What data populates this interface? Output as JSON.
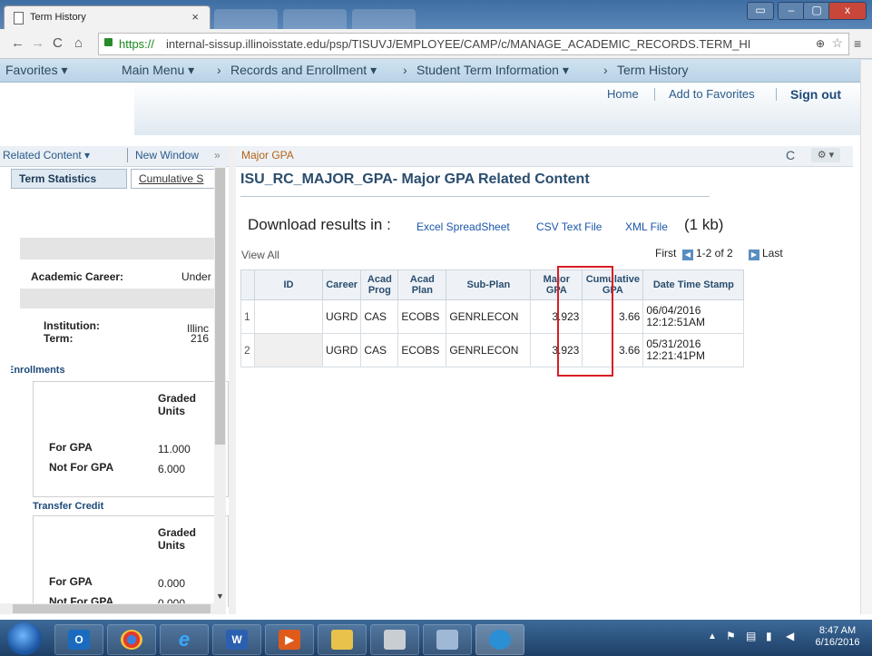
{
  "browser": {
    "tab_title": "Term History",
    "tab_close": "×",
    "url_https": "https://",
    "url_rest": "internal-sissup.illinoisstate.edu/psp/TISUVJ/EMPLOYEE/CAMP/c/MANAGE_ACADEMIC_RECORDS.TERM_HI",
    "window_buttons": [
      "▭",
      "–",
      "▢",
      "x"
    ]
  },
  "nav": {
    "favorites": "Favorites ▾",
    "main_menu": "Main Menu ▾",
    "sep1": "›",
    "records": "Records and Enrollment ▾",
    "sep2": "›",
    "student_term": "Student Term Information ▾",
    "sep3": "›",
    "term_history": "Term History"
  },
  "header": {
    "home": "Home",
    "add_favorites": "Add to Favorites",
    "sign_out": "Sign out"
  },
  "left": {
    "related_content": "Related Content ▾",
    "new_window": "New Window",
    "collapse": "»",
    "tabs": [
      "Term Statistics",
      "Cumulative S"
    ],
    "academic_career_label": "Academic Career:",
    "academic_career_value": "Under",
    "institution_label": "Institution:",
    "institution_value": "Illinc",
    "term_label": "Term:",
    "term_value": "216",
    "enrollments": "Enrollments",
    "transfer_credit": "Transfer Credit",
    "graded_units": "Graded Units",
    "enroll_rows": [
      {
        "label": "For GPA",
        "value": "11.000"
      },
      {
        "label": "Not For GPA",
        "value": "6.000"
      }
    ],
    "transfer_rows": [
      {
        "label": "For GPA",
        "value": "0.000"
      },
      {
        "label": "Not For GPA",
        "value": "0.000"
      }
    ]
  },
  "right": {
    "panel_title": "Major GPA",
    "refresh_icon": "C",
    "gear": "⚙ ▾",
    "page_title": "ISU_RC_MAJOR_GPA- Major GPA Related Content",
    "download_label": "Download results in :",
    "excel": "Excel SpreadSheet",
    "csv": "CSV Text File",
    "xml": "XML File",
    "size": "(1 kb)",
    "view_all": "View All",
    "pager_first": "First",
    "pager_range": "1-2 of 2",
    "pager_last": "Last",
    "columns": [
      "ID",
      "Career",
      "Acad Prog",
      "Acad Plan",
      "Sub-Plan",
      "Major GPA",
      "Cumulative GPA",
      "Date Time Stamp"
    ],
    "rows": [
      {
        "n": "1",
        "id": "",
        "career": "UGRD",
        "prog": "CAS",
        "plan": "ECOBS",
        "subplan": "GENRLECON",
        "major_gpa": "3.923",
        "cum_gpa": "3.66",
        "date": "06/04/2016",
        "time": "12:12:51AM"
      },
      {
        "n": "2",
        "id": "",
        "career": "UGRD",
        "prog": "CAS",
        "plan": "ECOBS",
        "subplan": "GENRLECON",
        "major_gpa": "3.923",
        "cum_gpa": "3.66",
        "date": "05/31/2016",
        "time": "12:21:41PM"
      }
    ]
  },
  "taskbar": {
    "time": "8:47 AM",
    "date": "6/16/2016",
    "apps": [
      "outlook-icon",
      "chrome-icon",
      "ie-icon",
      "word-icon",
      "media-icon",
      "explorer-icon",
      "calculator-icon",
      "notes-icon",
      "app-icon"
    ]
  }
}
